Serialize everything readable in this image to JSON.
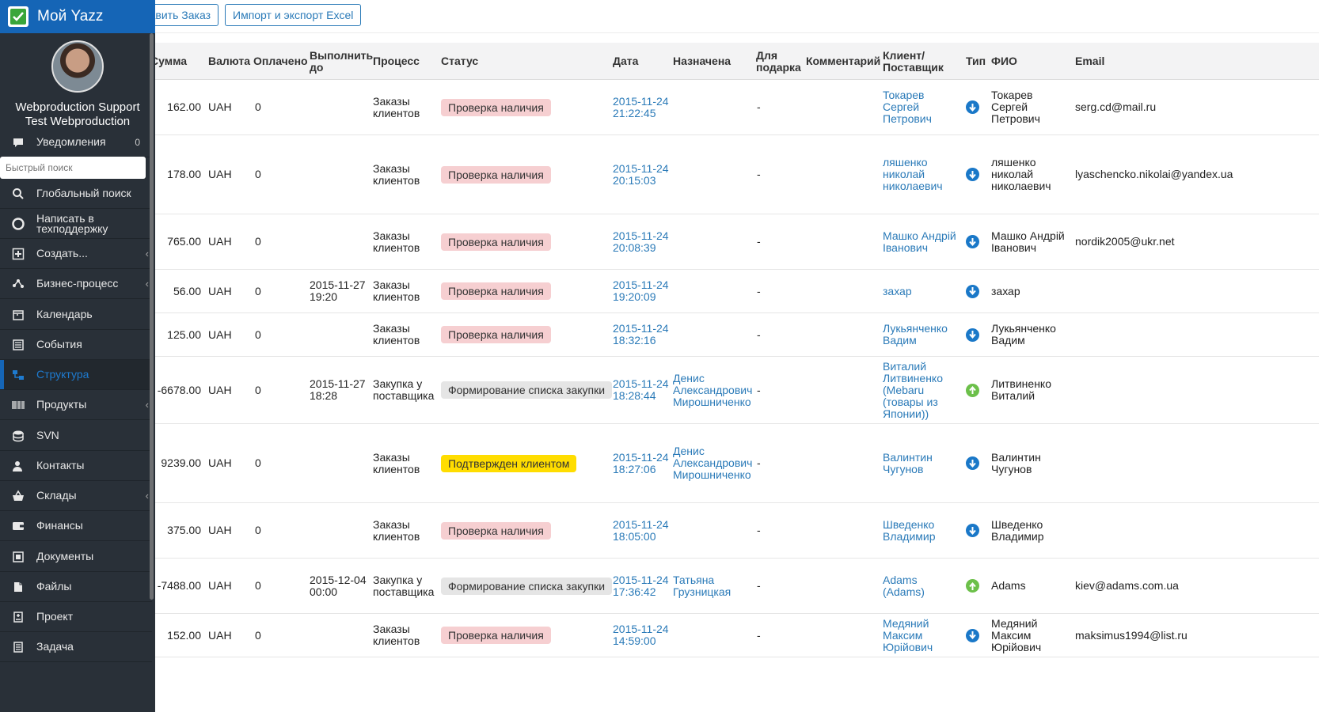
{
  "toolbar": {
    "add_label": "Добавить Заказ",
    "import_label": "Импорт и экспорт Excel"
  },
  "columns": [
    "Сумма",
    "Валюта",
    "Оплачено",
    "Выполнить до",
    "Процесс",
    "Статус",
    "Дата",
    "Назначена",
    "Для подарка",
    "Комментарий",
    "Клиент/ Поставщик",
    "Тип",
    "ФИО",
    "Email"
  ],
  "rows": [
    {
      "sum": "162.00",
      "currency": "UAH",
      "paid": "0",
      "due": "",
      "process": "Заказы клиентов",
      "status": "Проверка наличия",
      "status_color": "#f6cfd1",
      "date": "2015-11-24 21:22:45",
      "assigned": "",
      "gift": "-",
      "comment": "",
      "client": "Токарев Сергей Петрович",
      "type": "in",
      "fio": "Токарев Сергей Петрович",
      "email": "serg.cd@mail.ru"
    },
    {
      "sum": "178.00",
      "currency": "UAH",
      "paid": "0",
      "due": "",
      "process": "Заказы клиентов",
      "status": "Проверка наличия",
      "status_color": "#f6cfd1",
      "date": "2015-11-24 20:15:03",
      "assigned": "",
      "gift": "-",
      "comment": "",
      "client": "ляшенко николай николаевич",
      "type": "in",
      "fio": "ляшенко николай николаевич",
      "email": "lyaschencko.nikolai@yandex.ua"
    },
    {
      "sum": "765.00",
      "currency": "UAH",
      "paid": "0",
      "due": "",
      "process": "Заказы клиентов",
      "status": "Проверка наличия",
      "status_color": "#f6cfd1",
      "date": "2015-11-24 20:08:39",
      "assigned": "",
      "gift": "-",
      "comment": "",
      "client": "Машко Андрій Іванович",
      "type": "in",
      "fio": "Машко Андрій Іванович",
      "email": "nordik2005@ukr.net"
    },
    {
      "sum": "56.00",
      "currency": "UAH",
      "paid": "0",
      "due": "2015-11-27 19:20",
      "process": "Заказы клиентов",
      "status": "Проверка наличия",
      "status_color": "#f6cfd1",
      "date": "2015-11-24 19:20:09",
      "assigned": "",
      "gift": "-",
      "comment": "",
      "client": "захар",
      "type": "in",
      "fio": "захар",
      "email": ""
    },
    {
      "sum": "125.00",
      "currency": "UAH",
      "paid": "0",
      "due": "",
      "process": "Заказы клиентов",
      "status": "Проверка наличия",
      "status_color": "#f6cfd1",
      "date": "2015-11-24 18:32:16",
      "assigned": "",
      "gift": "-",
      "comment": "",
      "client": "Лукьянченко Вадим",
      "type": "in",
      "fio": "Лукьянченко Вадим",
      "email": ""
    },
    {
      "sum": "-6678.00",
      "currency": "UAH",
      "paid": "0",
      "due": "2015-11-27 18:28",
      "process": "Закупка у поставщика",
      "status": "Формирование списка закупки",
      "status_color": "#e5e5e5",
      "date": "2015-11-24 18:28:44",
      "assigned": "Денис Александрович Мирошниченко",
      "gift": "-",
      "comment": "",
      "client": "Виталий Литвиненко (Mebaru (товары из Японии))",
      "type": "out",
      "fio": "Литвиненко Виталий",
      "email": ""
    },
    {
      "sum": "9239.00",
      "currency": "UAH",
      "paid": "0",
      "due": "",
      "process": "Заказы клиентов",
      "status": "Подтвержден клиентом",
      "status_color": "#ffdd00",
      "date": "2015-11-24 18:27:06",
      "assigned": "Денис Александрович Мирошниченко",
      "gift": "-",
      "comment": "",
      "client": "Валинтин Чугунов",
      "type": "in",
      "fio": "Валинтин Чугунов",
      "email": ""
    },
    {
      "sum": "375.00",
      "currency": "UAH",
      "paid": "0",
      "due": "",
      "process": "Заказы клиентов",
      "status": "Проверка наличия",
      "status_color": "#f6cfd1",
      "date": "2015-11-24 18:05:00",
      "assigned": "",
      "gift": "-",
      "comment": "",
      "client": "Шведенко Владимир",
      "type": "in",
      "fio": "Шведенко Владимир",
      "email": ""
    },
    {
      "sum": "-7488.00",
      "currency": "UAH",
      "paid": "0",
      "due": "2015-12-04 00:00",
      "process": "Закупка у поставщика",
      "status": "Формирование списка закупки",
      "status_color": "#e5e5e5",
      "date": "2015-11-24 17:36:42",
      "assigned": "Татьяна Грузницкая",
      "gift": "-",
      "comment": "",
      "client": "Adams (Adams)",
      "type": "out",
      "fio": "Adams",
      "email": "kiev@adams.com.ua"
    },
    {
      "sum": "152.00",
      "currency": "UAH",
      "paid": "0",
      "due": "",
      "process": "Заказы клиентов",
      "status": "Проверка наличия",
      "status_color": "#f6cfd1",
      "date": "2015-11-24 14:59:00",
      "assigned": "",
      "gift": "-",
      "comment": "",
      "client": "Медяний Максим Юрійович",
      "type": "in",
      "fio": "Медяний Максим Юрійович",
      "email": "maksimus1994@list.ru"
    }
  ],
  "sidebar": {
    "app_title": "Мой Yazz",
    "user_line1": "Webproduction Support",
    "user_line2": "Test Webproduction",
    "search_placeholder": "Быстрый поиск",
    "items": [
      {
        "label": "Уведомления",
        "icon": "chat-icon",
        "count": "0"
      },
      {
        "label": "Глобальный поиск",
        "icon": "search-icon"
      },
      {
        "label": "Написать в техподдержку",
        "icon": "lifebuoy-icon"
      },
      {
        "label": "Создать...",
        "icon": "plus-square-icon",
        "chevron": true
      },
      {
        "label": "Бизнес-процесс",
        "icon": "share-icon",
        "chevron": true
      },
      {
        "label": "Календарь",
        "icon": "calendar-icon"
      },
      {
        "label": "События",
        "icon": "list-icon"
      },
      {
        "label": "Структура",
        "icon": "structure-icon",
        "active": true
      },
      {
        "label": "Продукты",
        "icon": "barcode-icon",
        "chevron": true
      },
      {
        "label": "SVN",
        "icon": "database-icon"
      },
      {
        "label": "Контакты",
        "icon": "user-icon"
      },
      {
        "label": "Склады",
        "icon": "basket-icon",
        "chevron": true
      },
      {
        "label": "Финансы",
        "icon": "wallet-icon"
      },
      {
        "label": "Документы",
        "icon": "document-icon"
      },
      {
        "label": "Файлы",
        "icon": "files-icon"
      },
      {
        "label": "Проект",
        "icon": "project-icon"
      },
      {
        "label": "Задача",
        "icon": "task-icon"
      }
    ]
  }
}
